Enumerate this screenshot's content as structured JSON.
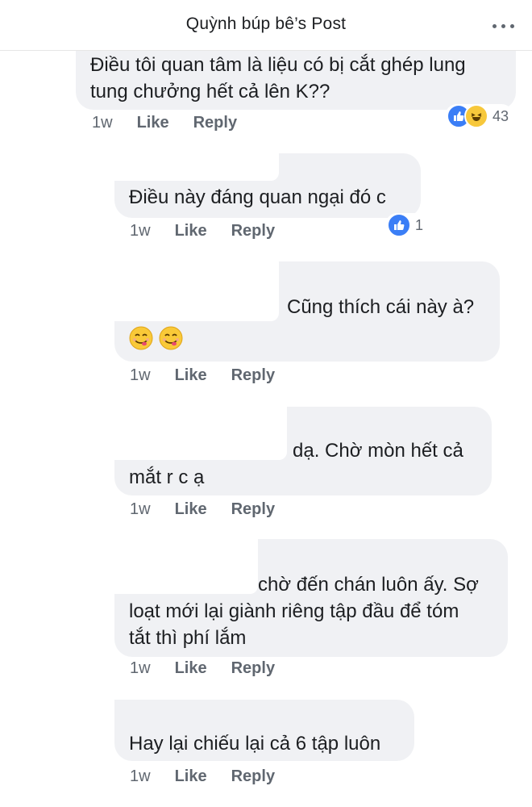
{
  "header": {
    "title": "Quỳnh búp bê’s Post"
  },
  "comments": [
    {
      "lines": [
        "Điều tôi quan tâm là liệu có bị cắt ghép lung",
        "tung chưởng hết cả lên K??"
      ],
      "time": "1w",
      "like": "Like",
      "reply": "Reply",
      "reaction_count": "43"
    },
    {
      "lines": [
        "Điều này đáng quan ngại đó c"
      ],
      "time": "1w",
      "like": "Like",
      "reply": "Reply",
      "reaction_count": "1"
    },
    {
      "lines": [
        "Cũng thích cái này à?"
      ],
      "emoji": [
        "yum-face",
        "yum-face"
      ],
      "time": "1w",
      "like": "Like",
      "reply": "Reply"
    },
    {
      "lines": [
        "dạ. Chờ mòn hết cả",
        "mắt r c ạ"
      ],
      "time": "1w",
      "like": "Like",
      "reply": "Reply"
    },
    {
      "lines": [
        "chờ đến chán luôn ấy. Sợ",
        "loạt mới lại giành riêng tập đầu để tóm",
        "tắt thì phí lắm"
      ],
      "time": "1w",
      "like": "Like",
      "reply": "Reply"
    },
    {
      "lines": [
        "Hay lại chiếu lại cả 6 tập luôn"
      ],
      "time": "1w",
      "like": "Like",
      "reply": "Reply"
    }
  ],
  "colors": {
    "bubble": "#f0f1f4",
    "like_blue": "#3b7ef6",
    "haha_yellow": "#f7c83b",
    "meta_gray": "#606770"
  },
  "icons": [
    "more-icon",
    "like-reaction-icon",
    "haha-reaction-icon",
    "yum-face-emoji"
  ]
}
